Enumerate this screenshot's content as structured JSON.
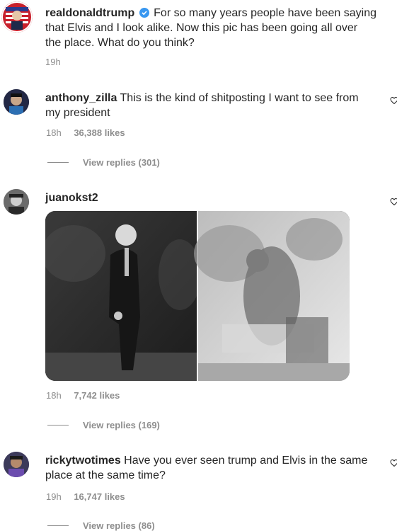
{
  "post": {
    "username": "realdonaldtrump",
    "caption_line1": "For so many years people have been saying",
    "caption_line2": "that Elvis and I look alike. Now this pic has been going all over",
    "caption_line3": "the place. What do you think?",
    "time": "19h"
  },
  "comments": [
    {
      "username": "anthony_zilla",
      "text_line1": "This is the kind of shitposting I want to see from",
      "text_line2": "my president",
      "time": "18h",
      "likes": "36,388 likes",
      "replies": "View replies (301)"
    },
    {
      "username": "juanokst2",
      "time": "18h",
      "likes": "7,742 likes",
      "replies": "View replies (169)"
    },
    {
      "username": "rickytwotimes",
      "text_line1": "Have you ever seen trump and Elvis in the same",
      "text_line2": "place at the same time?",
      "time": "19h",
      "likes": "16,747 likes",
      "replies": "View replies (86)"
    }
  ],
  "icons": {
    "like": "heart-icon",
    "verified": "verified-badge-icon"
  },
  "colors": {
    "text": "#262626",
    "meta": "#8e8e8e",
    "verified": "#3897f0"
  }
}
